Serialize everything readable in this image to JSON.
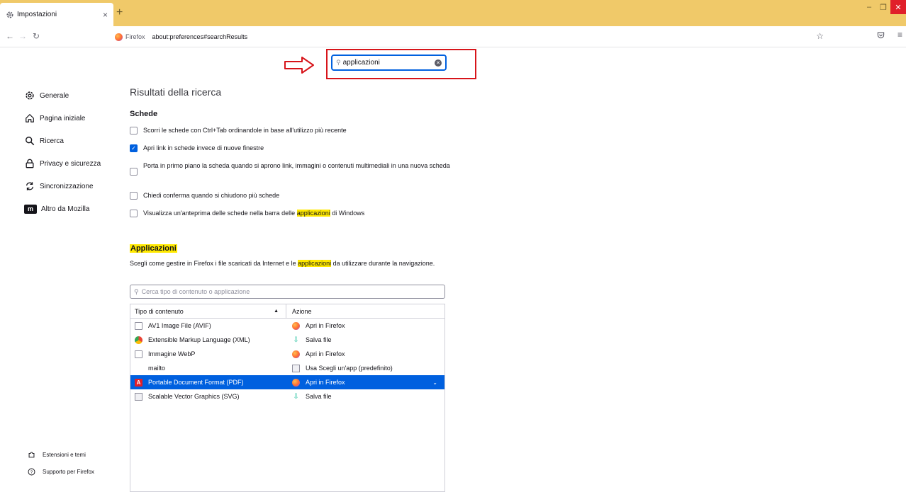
{
  "browser": {
    "tab_title": "Impostazioni",
    "tab_close": "×",
    "new_tab": "+",
    "url_brand": "Firefox",
    "url": "about:preferences#searchResults",
    "window_controls": {
      "minimize": "–",
      "restore": "❐",
      "close": "✕"
    }
  },
  "search": {
    "value": "applicazioni",
    "clear_label": "✕"
  },
  "sidebar": {
    "items": [
      {
        "label": "Generale",
        "icon": "gear-icon"
      },
      {
        "label": "Pagina iniziale",
        "icon": "home-icon"
      },
      {
        "label": "Ricerca",
        "icon": "search-icon"
      },
      {
        "label": "Privacy e sicurezza",
        "icon": "lock-icon"
      },
      {
        "label": "Sincronizzazione",
        "icon": "sync-icon"
      },
      {
        "label": "Altro da Mozilla",
        "icon": "mozilla-icon"
      }
    ],
    "bottom": [
      {
        "label": "Estensioni e temi",
        "icon": "puzzle-icon"
      },
      {
        "label": "Supporto per Firefox",
        "icon": "help-icon"
      }
    ]
  },
  "main": {
    "title": "Risultati della ricerca",
    "tabs_section": {
      "title": "Schede",
      "options": [
        {
          "text": "Scorri le schede con Ctrl+Tab ordinandole in base all'utilizzo più recente",
          "checked": false
        },
        {
          "text": "Apri link in schede invece di nuove finestre",
          "checked": true
        },
        {
          "text": "Porta in primo piano la scheda quando si aprono link, immagini o contenuti multimediali in una nuova scheda",
          "checked": false
        },
        {
          "text": "Chiedi conferma quando si chiudono più schede",
          "checked": false
        },
        {
          "text_before": "Visualizza un'anteprima delle schede nella barra delle ",
          "highlight": "applicazioni",
          "text_after": " di Windows",
          "checked": false
        }
      ]
    },
    "apps_section": {
      "title": "Applicazioni",
      "desc_before": "Scegli come gestire in Firefox i file scaricati da Internet e le ",
      "desc_highlight": "applicazioni",
      "desc_after": " da utilizzare durante la navigazione.",
      "filter_placeholder": "Cerca tipo di contenuto o applicazione",
      "columns": {
        "type": "Tipo di contenuto",
        "sort_indicator": "▲",
        "action": "Azione"
      },
      "rows": [
        {
          "type": "AV1 Image File (AVIF)",
          "type_icon": "file-icon",
          "action": "Apri in Firefox",
          "action_icon": "firefox-icon"
        },
        {
          "type": "Extensible Markup Language (XML)",
          "type_icon": "chrome-icon",
          "action": "Salva file",
          "action_icon": "save-icon"
        },
        {
          "type": "Immagine WebP",
          "type_icon": "file-icon",
          "action": "Apri in Firefox",
          "action_icon": "firefox-icon"
        },
        {
          "type": "mailto",
          "type_icon": "",
          "action": "Usa Scegli un'app (predefinito)",
          "action_icon": "app-icon"
        },
        {
          "type": "Portable Document Format (PDF)",
          "type_icon": "pdf-icon",
          "action": "Apri in Firefox",
          "action_icon": "firefox-icon",
          "selected": true
        },
        {
          "type": "Scalable Vector Graphics (SVG)",
          "type_icon": "svg-icon",
          "action": "Salva file",
          "action_icon": "save-icon"
        }
      ]
    }
  },
  "colors": {
    "tabstrip": "#f0c969",
    "accent": "#0060df",
    "highlight": "#ffe900",
    "annotation": "#d7141a"
  }
}
